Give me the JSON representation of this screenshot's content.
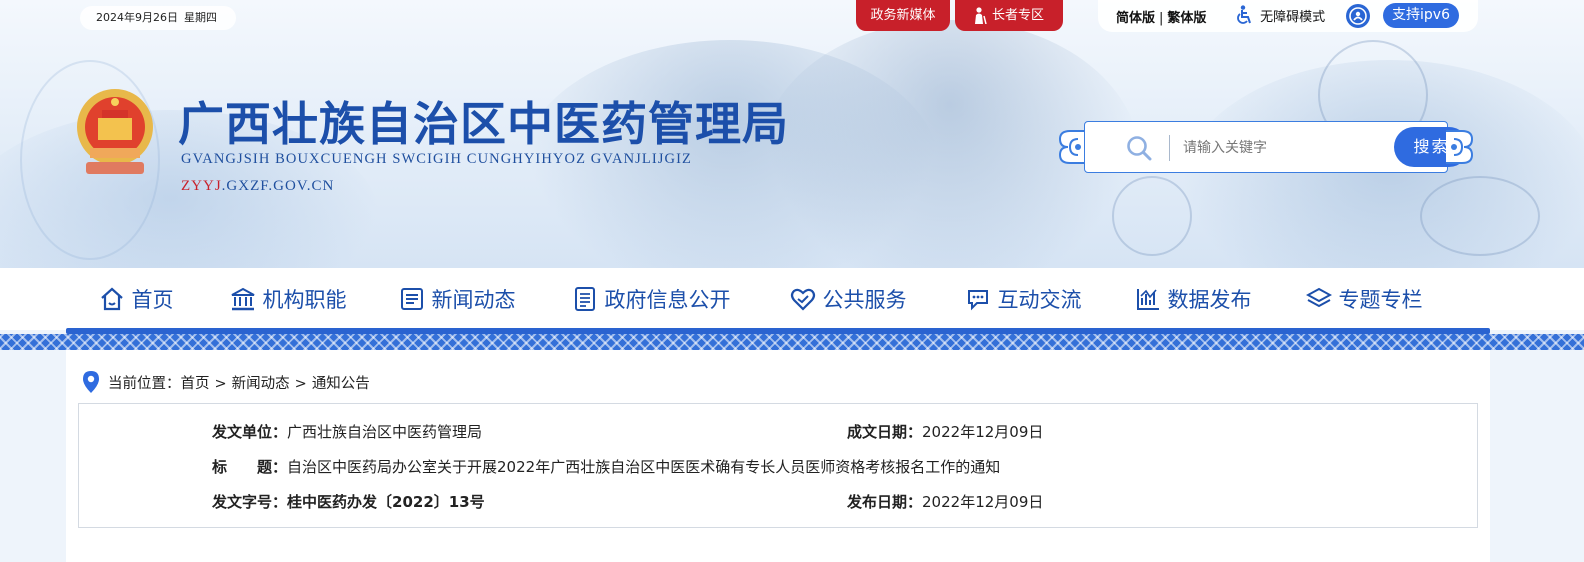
{
  "header": {
    "date": "2024年9月26日",
    "weekday": "星期四",
    "media_label": "政务新媒体",
    "elder_label": "长者专区",
    "lang_simplified": "简体版",
    "lang_separator": "|",
    "lang_traditional": "繁体版",
    "accessibility_label": "无障碍模式",
    "ipv6_label": "支持ipv6",
    "site_title": "广西壮族自治区中医药管理局",
    "site_pinyin": "GVANGJSIH BOUXCUENGH SWCIGIH CUNGHYIHYOZ GVANJLIJGIZ",
    "url_prefix": "ZYYJ",
    "url_suffix": ".GXZF.GOV.CN",
    "search_placeholder": "请输入关键字",
    "search_button": "搜索"
  },
  "nav": {
    "items": [
      {
        "label": "首页",
        "icon": "home-icon"
      },
      {
        "label": "机构职能",
        "icon": "institution-icon"
      },
      {
        "label": "新闻动态",
        "icon": "news-icon"
      },
      {
        "label": "政府信息公开",
        "icon": "document-list-icon"
      },
      {
        "label": "公共服务",
        "icon": "heart-hands-icon"
      },
      {
        "label": "互动交流",
        "icon": "chat-icon"
      },
      {
        "label": "数据发布",
        "icon": "data-chart-icon"
      },
      {
        "label": "专题专栏",
        "icon": "layers-icon"
      }
    ]
  },
  "breadcrumb": {
    "prefix": "当前位置：",
    "items": [
      "首页",
      "新闻动态",
      "通知公告"
    ],
    "separator": ">"
  },
  "document": {
    "issuer_label": "发文单位：",
    "issuer": "广西壮族自治区中医药管理局",
    "created_label": "成文日期：",
    "created": "2022年12月09日",
    "title_label": "标　　题：",
    "title": "自治区中医药局办公室关于开展2022年广西壮族自治区中医医术确有专长人员医师资格考核报名工作的通知",
    "number_label": "发文字号：",
    "number": "桂中医药办发〔2022〕13号",
    "published_label": "发布日期：",
    "published": "2022年12月09日"
  },
  "colors": {
    "brand_blue": "#1c4faa",
    "accent_blue": "#2f6be0",
    "red": "#c8202a"
  }
}
